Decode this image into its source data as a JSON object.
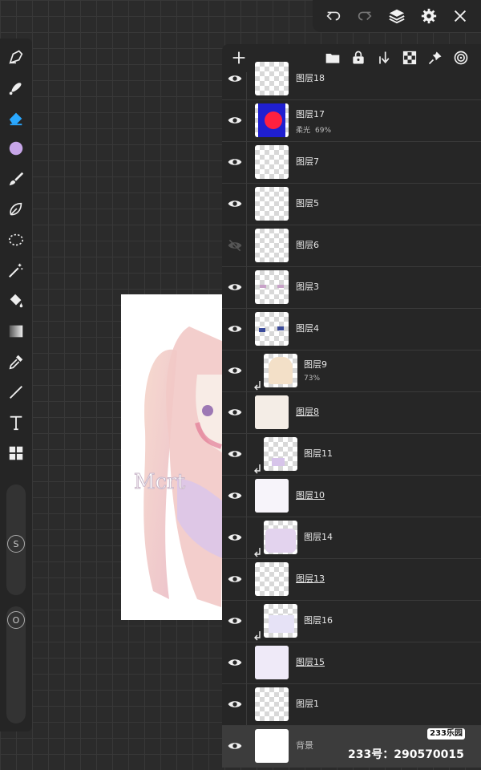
{
  "toolbar": {
    "undo_icon": "undo-icon",
    "redo_icon": "redo-icon",
    "layers_icon": "layers-icon",
    "settings_icon": "gear-icon",
    "close_icon": "close-icon"
  },
  "tools": [
    {
      "name": "pen-tool",
      "icon": "pen-icon"
    },
    {
      "name": "blur-tool",
      "icon": "smudge-icon"
    },
    {
      "name": "eraser-tool",
      "icon": "eraser-icon",
      "active": true
    },
    {
      "name": "color-swatch",
      "icon": "color-circle",
      "color": "#c7a6e8"
    },
    {
      "name": "brush-tool",
      "icon": "brush-icon"
    },
    {
      "name": "lasso-tool",
      "icon": "lasso-icon"
    },
    {
      "name": "selection-tool",
      "icon": "dotted-selection-icon"
    },
    {
      "name": "magic-wand-tool",
      "icon": "magic-wand-icon"
    },
    {
      "name": "fill-tool",
      "icon": "bucket-icon"
    },
    {
      "name": "gradient-tool",
      "icon": "gradient-icon"
    },
    {
      "name": "eyedropper-tool",
      "icon": "eyedropper-icon"
    },
    {
      "name": "line-tool",
      "icon": "line-icon"
    },
    {
      "name": "text-tool",
      "icon": "text-icon"
    },
    {
      "name": "grid-tool",
      "icon": "grid-icon"
    }
  ],
  "size_slider": {
    "label": "S"
  },
  "opacity_slider": {
    "label": "O"
  },
  "layers_header": {
    "add_icon": "plus-icon",
    "icons": [
      "folder-icon",
      "lock-icon",
      "merge-down-icon",
      "transparency-icon",
      "pin-icon",
      "spiral-icon"
    ]
  },
  "layers": [
    {
      "name": "图层18",
      "visible": true
    },
    {
      "name": "图层17",
      "blend": "柔光",
      "opacity": "69%",
      "visible": true
    },
    {
      "name": "图层7",
      "visible": true
    },
    {
      "name": "图层5",
      "visible": true
    },
    {
      "name": "图层6",
      "visible": false
    },
    {
      "name": "图层3",
      "visible": true
    },
    {
      "name": "图层4",
      "visible": true
    },
    {
      "name": "图层9",
      "opacity": "73%",
      "clip": true,
      "visible": true
    },
    {
      "name": "图层8",
      "underline": true,
      "visible": true
    },
    {
      "name": "图层11",
      "clip": true,
      "visible": true
    },
    {
      "name": "图层10",
      "underline": true,
      "visible": true
    },
    {
      "name": "图层14",
      "clip": true,
      "visible": true
    },
    {
      "name": "图层13",
      "underline": true,
      "visible": true
    },
    {
      "name": "图层16",
      "clip": true,
      "visible": true
    },
    {
      "name": "图层15",
      "underline": true,
      "visible": true
    },
    {
      "name": "图层1",
      "visible": true
    },
    {
      "name": "背景",
      "visible": true,
      "background": true
    }
  ],
  "watermark": {
    "badge": "233乐园",
    "text": "233号：290570015"
  },
  "canvas_art": {
    "signature": "Mcrt"
  }
}
